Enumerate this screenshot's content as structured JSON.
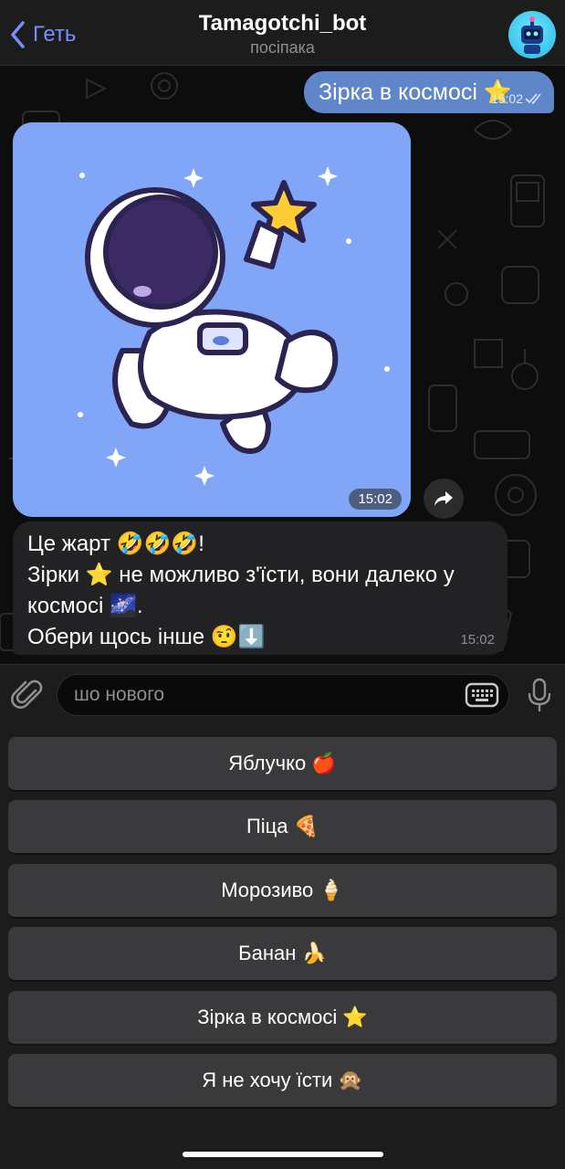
{
  "header": {
    "back_label": "Геть",
    "title": "Tamagotchi_bot",
    "subtitle": "посіпака"
  },
  "messages": {
    "outgoing": {
      "text": "Зірка в космосі ⭐",
      "time": "15:02"
    },
    "photo": {
      "time": "15:02"
    },
    "incoming": {
      "lines": [
        "Це жарт 🤣🤣🤣!",
        "Зірки ⭐ не можливо з'їсти, вони далеко у",
        "космосі 🌌.",
        "Обери щось інше 🤨⬇️"
      ],
      "time": "15:02"
    }
  },
  "input": {
    "placeholder": "шо нового"
  },
  "keyboard": {
    "buttons": [
      "Яблучко 🍎",
      "Піца 🍕",
      "Морозиво 🍦",
      "Банан 🍌",
      "Зірка в космосі ⭐",
      "Я не хочу їсти 🙊"
    ]
  },
  "colors": {
    "accent": "#7a8cff",
    "outgoing_bubble": "#5e86c9",
    "incoming_bubble": "#222224",
    "photo_background": "#82a6f7",
    "keyboard_button": "#3a3a3c"
  }
}
